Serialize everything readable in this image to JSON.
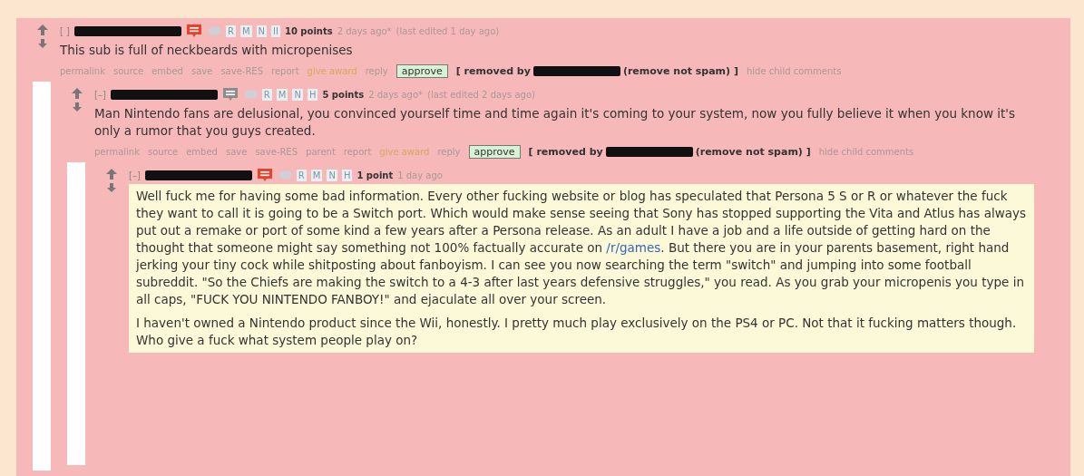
{
  "comments": [
    {
      "collapse": "[ ]",
      "author_redacted": true,
      "color": "#e8432d",
      "tags": [
        "R",
        "M",
        "N",
        "II"
      ],
      "points": "10 points",
      "age": "2 days ago*",
      "edited": "(last edited 1 day ago)",
      "highlighted": false,
      "body": [
        {
          "parts": [
            {
              "kind": "text",
              "text": "This sub is full of neckbeards with micropenises"
            }
          ]
        }
      ],
      "actions": [
        {
          "kind": "link",
          "text": "permalink"
        },
        {
          "kind": "link",
          "text": "source"
        },
        {
          "kind": "link",
          "text": "embed"
        },
        {
          "kind": "link",
          "text": "save"
        },
        {
          "kind": "link",
          "text": "save-RES"
        },
        {
          "kind": "link",
          "text": "report"
        },
        {
          "kind": "award",
          "text": "give award"
        },
        {
          "kind": "link",
          "text": "reply"
        }
      ],
      "approve": "approve",
      "removed_by": "[ removed by",
      "remove_not_spam": "(remove not spam) ]",
      "hide": "hide child comments",
      "children": [
        {
          "collapse": "[–]",
          "author_redacted": true,
          "color": "#8c8c8c",
          "tags": [
            "R",
            "M",
            "N",
            "H"
          ],
          "points": "5 points",
          "age": "2 days ago*",
          "edited": "(last edited 2 days ago)",
          "highlighted": false,
          "body": [
            {
              "parts": [
                {
                  "kind": "text",
                  "text": "Man Nintendo fans are delusional, you convinced yourself time and time again it's coming to your system, now you fully believe it when you know it's only a rumor that you guys created."
                }
              ]
            }
          ],
          "actions": [
            {
              "kind": "link",
              "text": "permalink"
            },
            {
              "kind": "link",
              "text": "source"
            },
            {
              "kind": "link",
              "text": "embed"
            },
            {
              "kind": "link",
              "text": "save"
            },
            {
              "kind": "link",
              "text": "save-RES"
            },
            {
              "kind": "link",
              "text": "parent"
            },
            {
              "kind": "link",
              "text": "report"
            },
            {
              "kind": "award",
              "text": "give award"
            },
            {
              "kind": "link",
              "text": "reply"
            }
          ],
          "approve": "approve",
          "removed_by": "[ removed by",
          "remove_not_spam": "(remove not spam) ]",
          "hide": "hide child comments",
          "children": [
            {
              "collapse": "[–]",
              "author_redacted": true,
              "color": "#e8432d",
              "tags": [
                "R",
                "M",
                "N",
                "H"
              ],
              "points": "1 point",
              "age": "1 day ago",
              "highlighted": true,
              "body": [
                {
                  "parts": [
                    {
                      "kind": "text",
                      "text": "Well fuck me for having some bad information. Every other fucking website or blog has speculated that Persona 5 S or R or whatever the fuck they want to call it is going to be a Switch port. Which would make sense seeing that Sony has stopped supporting the Vita and Atlus has always put out a remake or port of some kind a few years after a Persona release. As an adult I have a job and a life outside of getting hard on the thought that someone might say something not 100% factually accurate on "
                    },
                    {
                      "kind": "link",
                      "text": "/r/games"
                    },
                    {
                      "kind": "text",
                      "text": ". But there you are in your parents basement, right hand jerking your tiny cock while shitposting about fanboyism. I can see you now searching the term \"switch\" and jumping into some football subreddit. \"So the Chiefs are making the switch to a 4-3 after last years defensive struggles,\" you read. As you grab your micropenis you type in all caps, \"FUCK YOU NINTENDO FANBOY!\" and ejaculate all over your screen."
                    }
                  ]
                },
                {
                  "parts": [
                    {
                      "kind": "text",
                      "text": "I haven't owned a Nintendo product since the Wii, honestly. I pretty much play exclusively on the PS4 or PC. Not that it fucking matters though. Who give a fuck what system people play on?"
                    }
                  ]
                }
              ]
            }
          ]
        }
      ]
    }
  ]
}
